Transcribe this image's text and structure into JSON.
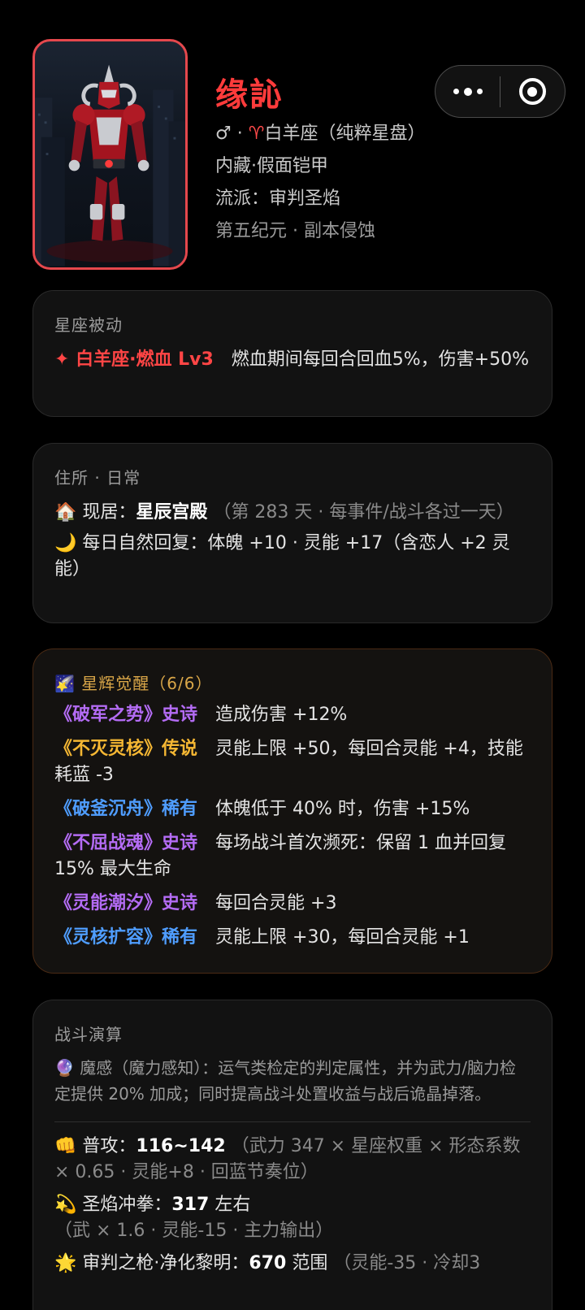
{
  "profile": {
    "name": "缘訫",
    "gender_sep": "♂ · ",
    "sign_icon": "♈",
    "sign_text": "白羊座（纯粹星盘）",
    "line2": "内藏·假面铠甲",
    "line3": "流派：审判圣焰",
    "line4": "第五纪元 · 副本侵蚀"
  },
  "capsule": {
    "more": "more-icon",
    "close": "target-icon"
  },
  "passive": {
    "title": "星座被动",
    "badge": "✦ 白羊座·燃血 Lv3",
    "desc": "燃血期间每回合回血5%，伤害+50%"
  },
  "residence": {
    "title": "住所 · 日常",
    "home_icon": "🏠",
    "home_label": "现居：",
    "home_value": "星辰宫殿",
    "home_note": "（第 283 天 · 每事件/战斗各过一天）",
    "daily_icon": "🌙",
    "daily_text": "每日自然回复：体魄 +10 · 灵能 +17（含恋人 +2 灵能）"
  },
  "awaken": {
    "title_icon": "🌠",
    "title": "星辉觉醒",
    "count": "（6/6）",
    "items": [
      {
        "name": "《破军之势》史诗",
        "rarity": "epic",
        "desc": "造成伤害 +12%"
      },
      {
        "name": "《不灭灵核》传说",
        "rarity": "legend",
        "desc": "灵能上限 +50，每回合灵能 +4，技能耗蓝 -3"
      },
      {
        "name": "《破釜沉舟》稀有",
        "rarity": "rare",
        "desc": "体魄低于 40% 时，伤害 +15%"
      },
      {
        "name": "《不屈战魂》史诗",
        "rarity": "epic",
        "desc": "每场战斗首次濒死：保留 1 血并回复 15% 最大生命"
      },
      {
        "name": "《灵能潮汐》史诗",
        "rarity": "epic",
        "desc": "每回合灵能 +3"
      },
      {
        "name": "《灵核扩容》稀有",
        "rarity": "rare",
        "desc": "灵能上限 +30，每回合灵能 +1"
      }
    ]
  },
  "combat": {
    "title": "战斗演算",
    "sense_icon": "🔮",
    "sense_text": "魔感（魔力感知）：运气类检定的判定属性，并为武力/脑力检定提供 20% 加成；同时提高战斗处置收益与战后诡晶掉落。",
    "atk_icon": "👊",
    "atk_label": "普攻：",
    "atk_value": "116~142",
    "atk_note": "（武力 347 × 星座权重 × 形态系数 × 0.65 · 灵能+8 · 回蓝节奏位）",
    "skill_icon": "💫",
    "skill_label": "圣焰冲拳：",
    "skill_value": "317",
    "skill_suffix": " 左右",
    "skill_note": "（武 × 1.6 · 灵能-15 · 主力输出）",
    "ult_icon": "🌟",
    "ult_label": "审判之枪·净化黎明：",
    "ult_value": "670",
    "ult_suffix": " 范围",
    "ult_note": "（灵能-35 · 冷却3"
  },
  "colors": {
    "accent": "#ff3b3b",
    "epic": "#b46cf5",
    "legend": "#f5b733",
    "rare": "#4f9dff"
  }
}
